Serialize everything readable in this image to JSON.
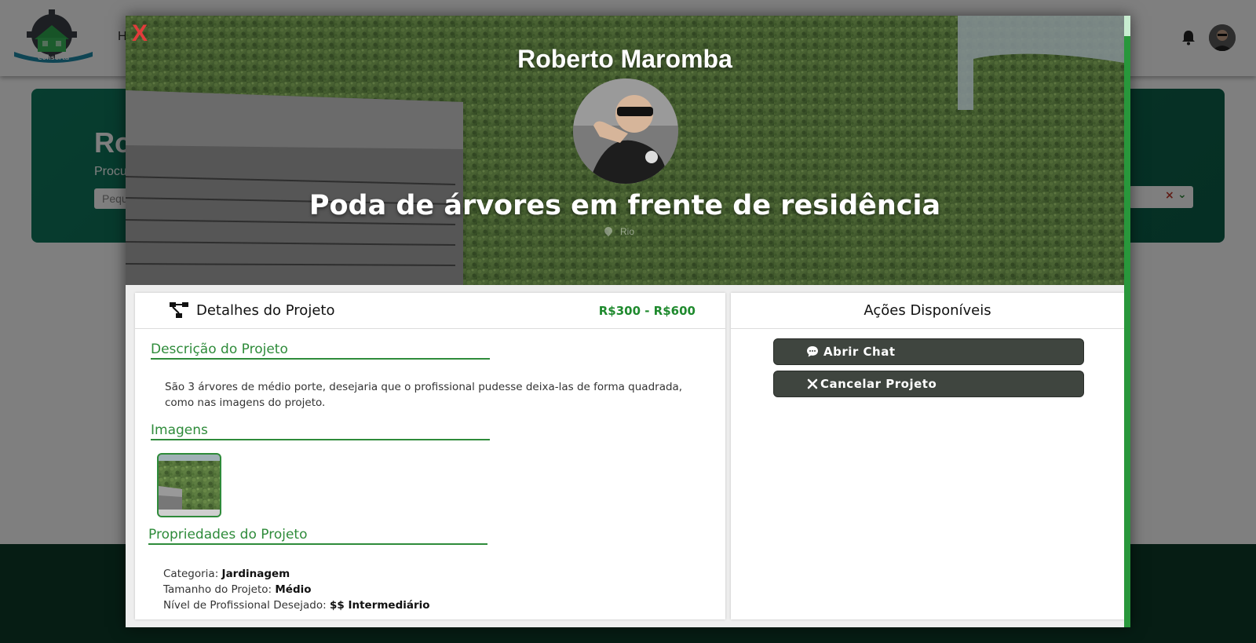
{
  "background": {
    "logo_text": "Conserta",
    "nav_first": "H",
    "hero_title_partial": "Ro",
    "hero_sub_partial": "Procu",
    "search_placeholder_partial": "Pequ",
    "select_clear": "×",
    "select_chevron": "⌄"
  },
  "modal": {
    "close_label": "X",
    "owner_name": "Roberto Maromba",
    "project_title": "Poda de árvores em frente de residência",
    "location": "Rio",
    "details": {
      "title": "Detalhes do Projeto",
      "price": "R$300 - R$600",
      "description_title": "Descrição do Projeto",
      "description_text": "São 3 árvores de médio porte, desejaria que o profissional pudesse deixa-las de forma quadrada, como nas imagens do projeto.",
      "images_title": "Imagens",
      "properties_title": "Propriedades do Projeto",
      "properties": [
        {
          "label": "Categoria:",
          "value": "Jardinagem"
        },
        {
          "label": "Tamanho do Projeto:",
          "value": "Médio"
        },
        {
          "label": "Nível de Profissional Desejado:",
          "value": "$$ Intermediário"
        }
      ]
    },
    "actions": {
      "title": "Ações Disponíveis",
      "buttons": [
        {
          "label": "Abrir Chat",
          "icon": "chat-bubble-icon"
        },
        {
          "label": "Cancelar Projeto",
          "icon": "close-icon"
        }
      ]
    }
  },
  "colors": {
    "accent_green": "#2e8b3a",
    "close_red": "#e23b3b",
    "button_dark": "#3f453f",
    "hero_teal": "#0e6a52",
    "footer_dark": "#0d3b28"
  }
}
